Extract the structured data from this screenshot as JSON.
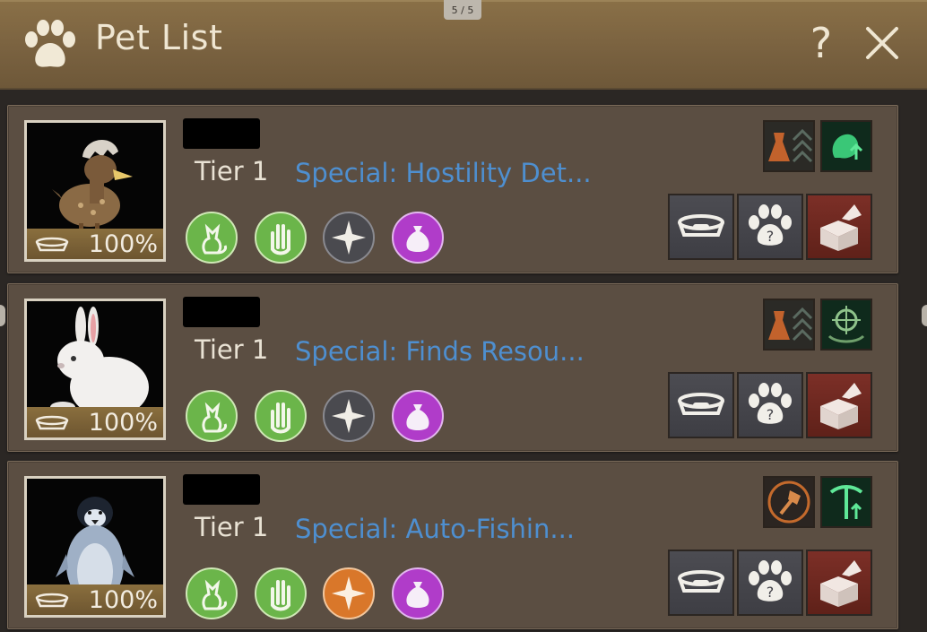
{
  "page_indicator": "5 / 5",
  "window": {
    "title": "Pet List",
    "help_label": "?",
    "close_icon": "close-icon"
  },
  "pets": [
    {
      "name": "",
      "tier": "Tier 1",
      "special": "Special: Hostility Det...",
      "hunger": "100%",
      "portrait": "dodo-chick",
      "talents": [
        "alchemy-talent-icon",
        "gathering-talent-icon"
      ],
      "skills": [
        {
          "icon": "cat-icon",
          "color": "#6bb54a"
        },
        {
          "icon": "hand-icon",
          "color": "#6bb54a"
        },
        {
          "icon": "compass-icon",
          "color": "#4a4a4f"
        },
        {
          "icon": "loot-bag-icon",
          "color": "#b03cc9"
        }
      ]
    },
    {
      "name": "",
      "tier": "Tier 1",
      "special": "Special: Finds Resou...",
      "hunger": "100%",
      "portrait": "white-rabbit",
      "talents": [
        "alchemy-talent-icon",
        "target-talent-icon"
      ],
      "skills": [
        {
          "icon": "cat-icon",
          "color": "#6bb54a"
        },
        {
          "icon": "hand-icon",
          "color": "#6bb54a"
        },
        {
          "icon": "compass-icon",
          "color": "#4a4a4f"
        },
        {
          "icon": "loot-bag-icon",
          "color": "#b03cc9"
        }
      ]
    },
    {
      "name": "",
      "tier": "Tier 1",
      "special": "Special: Auto-Fishin...",
      "hunger": "100%",
      "portrait": "penguin",
      "talents": [
        "axe-talent-icon",
        "mining-talent-icon"
      ],
      "skills": [
        {
          "icon": "cat-icon",
          "color": "#6bb54a"
        },
        {
          "icon": "hand-icon",
          "color": "#6bb54a"
        },
        {
          "icon": "compass-icon",
          "color": "#d9772a"
        },
        {
          "icon": "loot-bag-icon",
          "color": "#b03cc9"
        }
      ]
    }
  ],
  "actions": [
    "feed-button",
    "pet-info-button",
    "seal-button"
  ],
  "colors": {
    "header": "#7a6240",
    "card": "#5b4e42",
    "special_text": "#4e8fd0",
    "seal_button": "#6e2a22"
  }
}
